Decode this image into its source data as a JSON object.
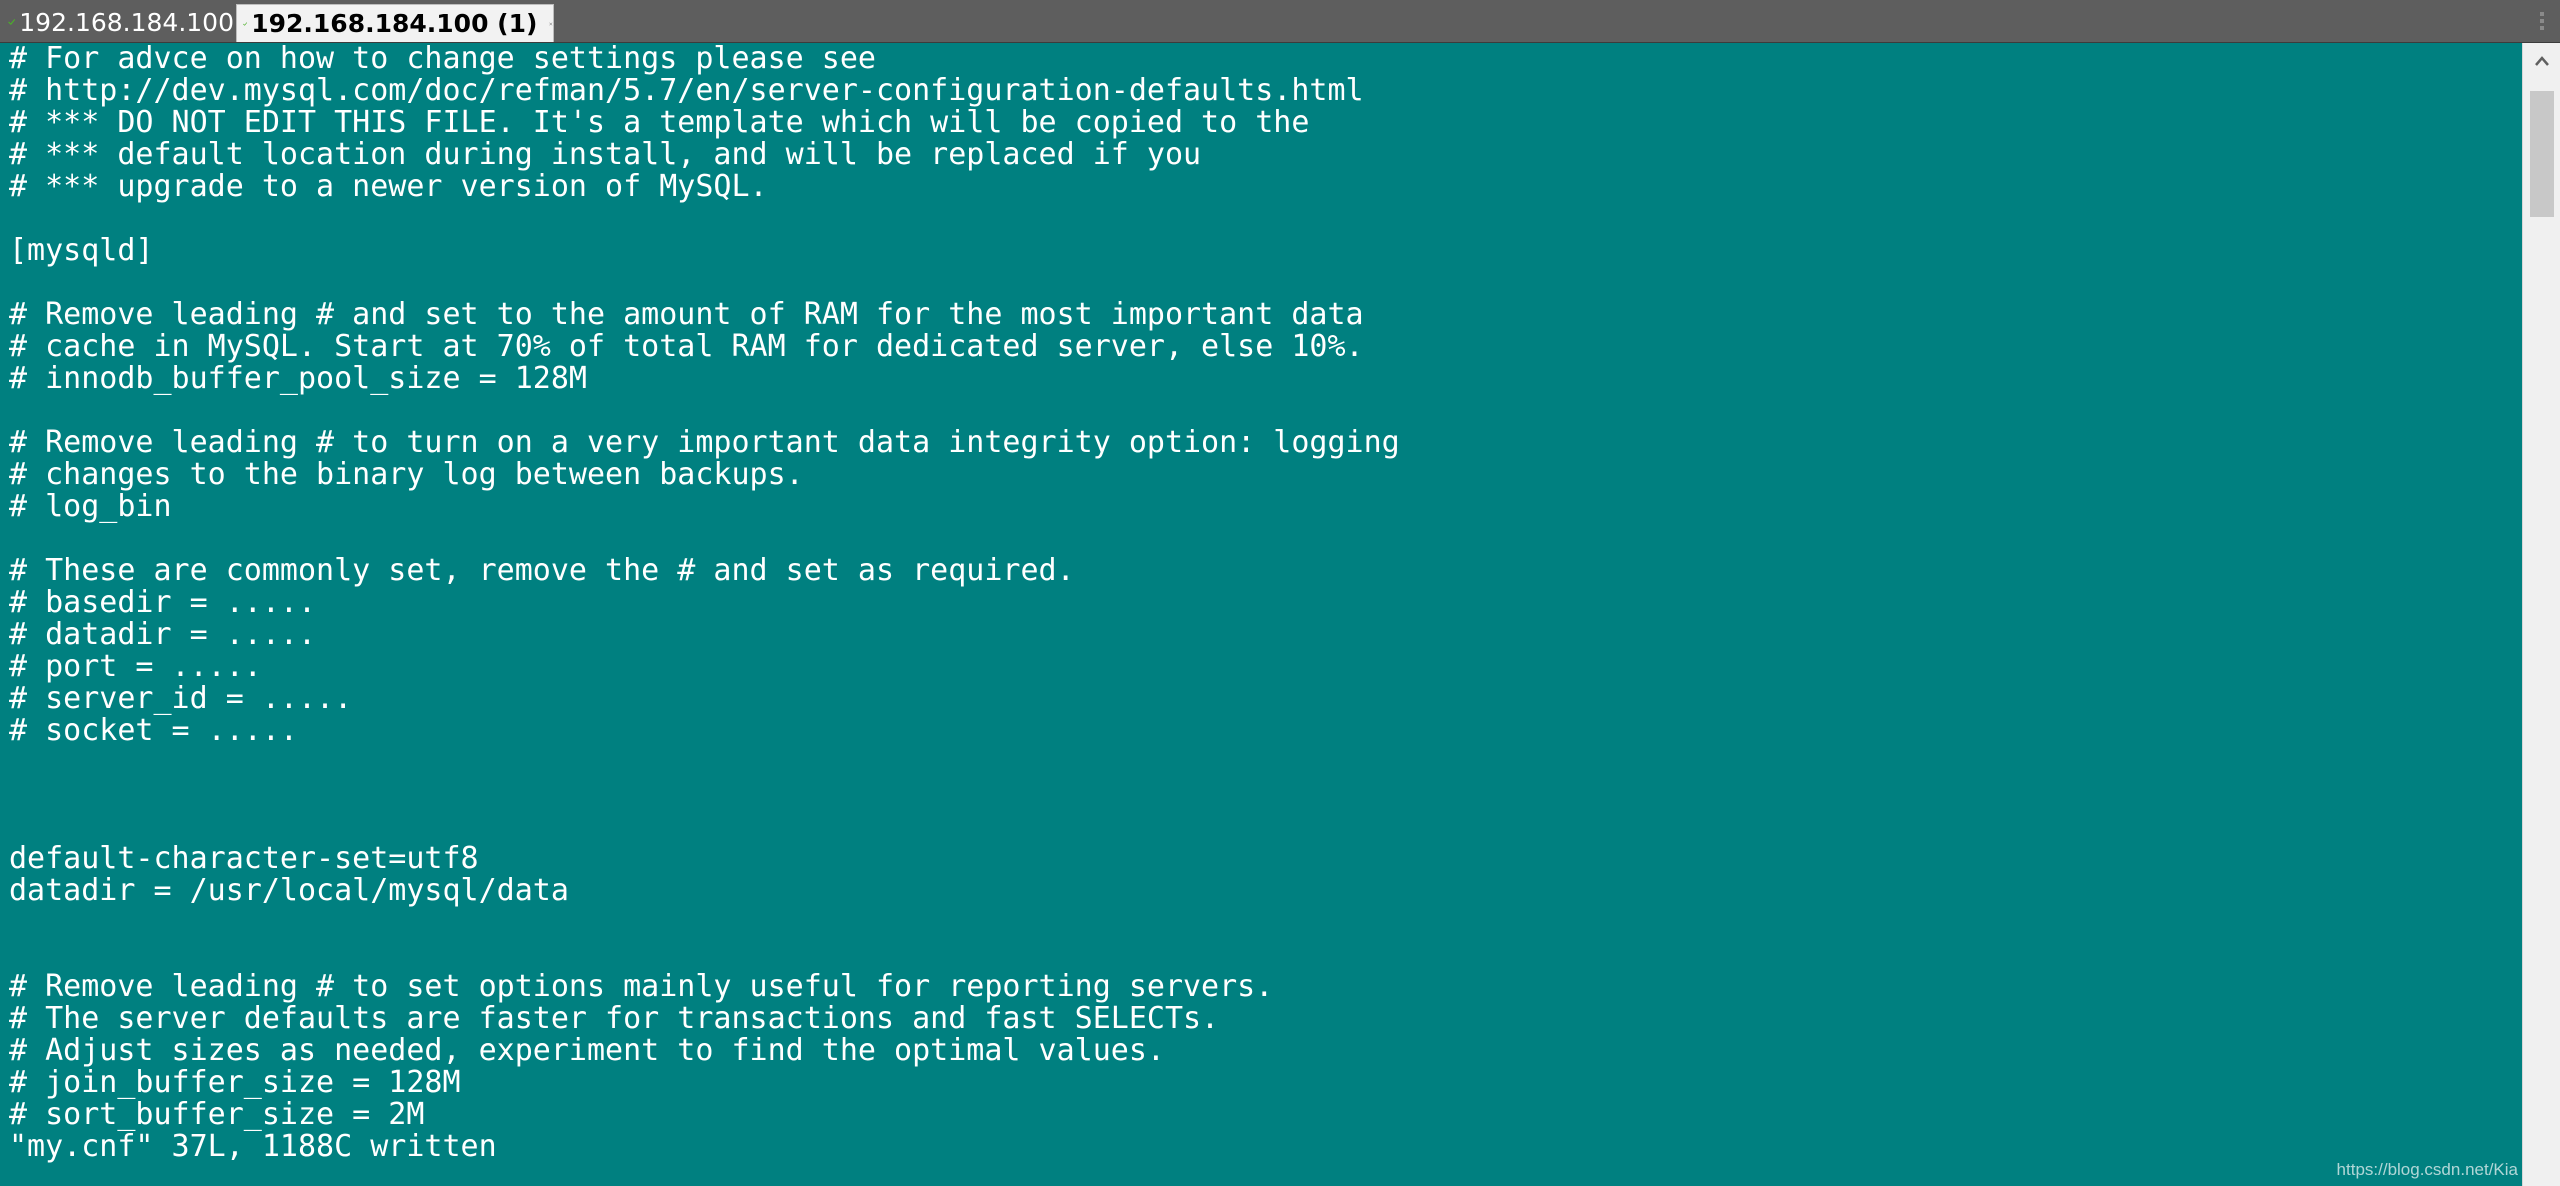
{
  "tabs": [
    {
      "label": "192.168.184.100",
      "active": false,
      "status_icon": "check-icon"
    },
    {
      "label": "192.168.184.100 (1)",
      "active": true,
      "status_icon": "check-icon",
      "close_icon": "close-icon"
    }
  ],
  "colors": {
    "terminal_background": "#008080",
    "terminal_text": "#ffffff",
    "check_green": "#4caf2a",
    "tabbar_background": "#5e5e5e"
  },
  "terminal": {
    "lines": [
      "# For advce on how to change settings please see",
      "# http://dev.mysql.com/doc/refman/5.7/en/server-configuration-defaults.html",
      "# *** DO NOT EDIT THIS FILE. It's a template which will be copied to the",
      "# *** default location during install, and will be replaced if you",
      "# *** upgrade to a newer version of MySQL.",
      "",
      "[mysqld]",
      "",
      "# Remove leading # and set to the amount of RAM for the most important data",
      "# cache in MySQL. Start at 70% of total RAM for dedicated server, else 10%.",
      "# innodb_buffer_pool_size = 128M",
      "",
      "# Remove leading # to turn on a very important data integrity option: logging",
      "# changes to the binary log between backups.",
      "# log_bin",
      "",
      "# These are commonly set, remove the # and set as required.",
      "# basedir = .....",
      "# datadir = .....",
      "# port = .....",
      "# server_id = .....",
      "# socket = .....",
      "",
      "",
      "",
      "default-character-set=utf8",
      "datadir = /usr/local/mysql/data",
      "",
      "",
      "# Remove leading # to set options mainly useful for reporting servers.",
      "# The server defaults are faster for transactions and fast SELECTs.",
      "# Adjust sizes as needed, experiment to find the optimal values.",
      "# join_buffer_size = 128M",
      "# sort_buffer_size = 2M"
    ],
    "status_line": "\"my.cnf\" 37L, 1188C written"
  },
  "watermark": "https://blog.csdn.net/Kia"
}
